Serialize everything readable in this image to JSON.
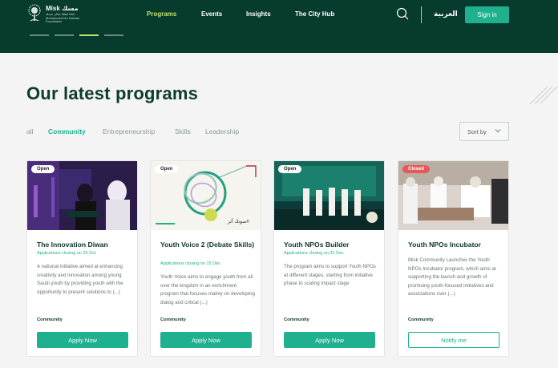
{
  "header": {
    "logo": {
      "name_en": "Misk",
      "name_ar": "مسك",
      "sub": "مكان مسك Misk Hub",
      "tagline": "Mohammed bin Salman Foundation"
    },
    "nav": [
      {
        "label": "Programs",
        "active": true
      },
      {
        "label": "Events",
        "active": false
      },
      {
        "label": "Insights",
        "active": false
      },
      {
        "label": "The City Hub",
        "active": false
      }
    ],
    "language_label": "العربية",
    "signin_label": "Sign in",
    "slide_count": 4,
    "active_slide": 3
  },
  "main": {
    "title": "Our latest programs",
    "filters": [
      {
        "label": "all",
        "active": false
      },
      {
        "label": "Community",
        "active": true
      },
      {
        "label": "Entrepreneurship",
        "active": false
      },
      {
        "label": "Skills",
        "active": false
      },
      {
        "label": "Leadership",
        "active": false
      }
    ],
    "sort_label": "Sort by"
  },
  "cards": [
    {
      "status": "Open",
      "title": "The Innovation Diwan",
      "closing": "Applications closing on 20 Oct",
      "description": "A national initiative aimed at enhancing creativity and innovation among young Saudi youth by providing youth with the opportunity to present solutions to (...)",
      "category": "Community",
      "button": "Apply Now"
    },
    {
      "status": "Open",
      "title": "Youth Voice 2 (Debate Skills)",
      "closing": "Applications closing on 15 Dec",
      "description": "Youth Voice aims to engage youth from all over the kingdom in an enrichment program that focuses mainly on developing dialog and critical (...)",
      "category": "Community",
      "button": "Apply Now",
      "image_caption": "صوتك أثر#"
    },
    {
      "status": "Open",
      "title": "Youth NPOs Builder",
      "closing": "Applications closing on 31 Dec",
      "description": "The program aims to support Youth NPOs at different stages, starting from initiative phase to scaling impact stage",
      "category": "Community",
      "button": "Apply Now"
    },
    {
      "status": "Closed",
      "title": "Youth NPOs Incubator",
      "closing": "",
      "description": "Misk Community Launches the Youth NPOs Incubator program, which aims at supporting the launch and growth of promising youth-focused initiatives and associations over (...)",
      "category": "Community",
      "button": "Notify me"
    }
  ],
  "colors": {
    "header_bg": "#063b2d",
    "accent": "#1fb08f",
    "active_nav": "#c6e26a",
    "closed": "#e85858"
  }
}
